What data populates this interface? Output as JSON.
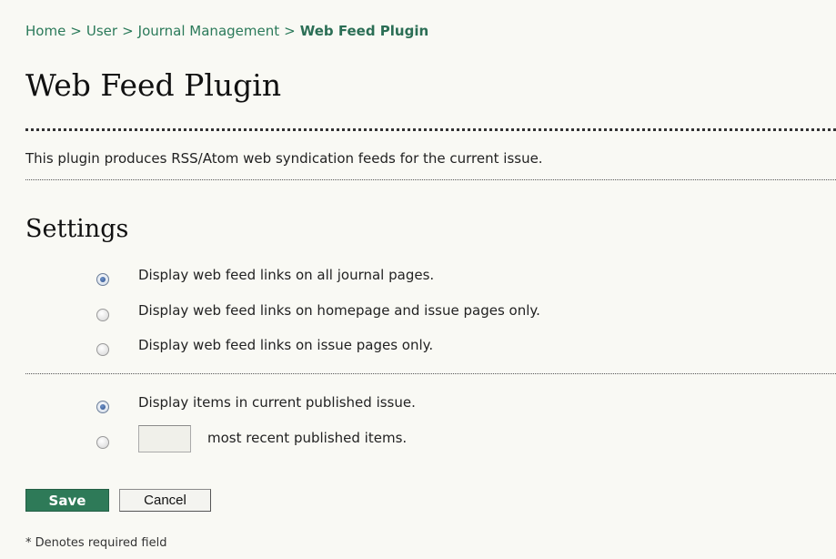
{
  "breadcrumb": {
    "items": [
      "Home",
      "User",
      "Journal Management"
    ],
    "separator": ">",
    "current": "Web Feed Plugin"
  },
  "page": {
    "title": "Web Feed Plugin",
    "description": "This plugin produces RSS/Atom web syndication feeds for the current issue."
  },
  "settings": {
    "title": "Settings",
    "display_options": [
      {
        "label": "Display web feed links on all journal pages.",
        "checked": true
      },
      {
        "label": "Display web feed links on homepage and issue pages only.",
        "checked": false
      },
      {
        "label": "Display web feed links on issue pages only.",
        "checked": false
      }
    ],
    "item_options": {
      "current_issue_label": "Display items in current published issue.",
      "current_issue_checked": true,
      "recent_items_label": "most recent published items.",
      "recent_items_value": "",
      "recent_items_checked": false
    }
  },
  "actions": {
    "save_label": "Save",
    "cancel_label": "Cancel"
  },
  "footer": {
    "required_note": "* Denotes required field"
  },
  "colors": {
    "link": "#2b7a5a",
    "save_button": "#2e7a58",
    "background": "#f9f9f4"
  }
}
